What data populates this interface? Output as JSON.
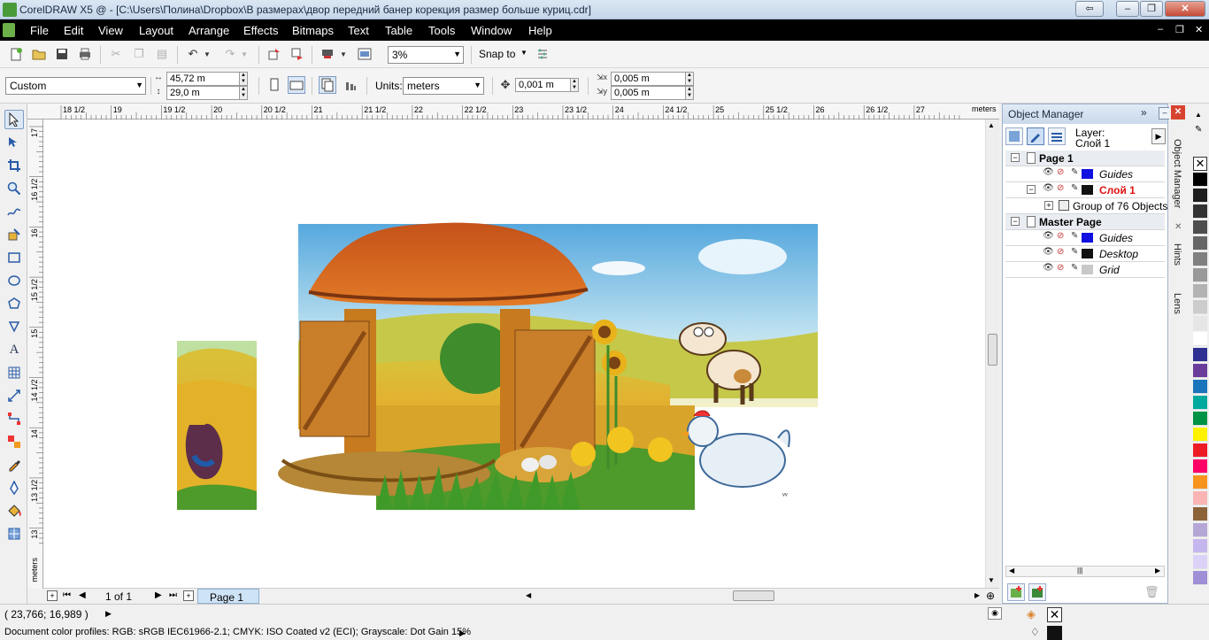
{
  "window": {
    "title": "CorelDRAW X5 @ - [C:\\Users\\Полина\\Dropbox\\В размерах\\двор передний банер корекция размер больше куриц.cdr]",
    "buttons": [
      "⇦",
      "‒",
      "❐",
      "✕"
    ]
  },
  "menu": {
    "items": [
      {
        "label": "File",
        "key": "F"
      },
      {
        "label": "Edit",
        "key": "E"
      },
      {
        "label": "View",
        "key": "V"
      },
      {
        "label": "Layout",
        "key": "L"
      },
      {
        "label": "Arrange",
        "key": "A"
      },
      {
        "label": "Effects",
        "key": "c"
      },
      {
        "label": "Bitmaps",
        "key": "B"
      },
      {
        "label": "Text",
        "key": "T"
      },
      {
        "label": "Table",
        "key": "T"
      },
      {
        "label": "Tools",
        "key": "o"
      },
      {
        "label": "Window",
        "key": "W"
      },
      {
        "label": "Help",
        "key": "H"
      }
    ],
    "mdi_buttons": [
      "‒",
      "❐",
      "✕"
    ]
  },
  "toolbar": {
    "zoom": "3%",
    "snap_to": "Snap to"
  },
  "property_bar": {
    "page_preset": "Custom",
    "width": "45,72 m",
    "height": "29,0 m",
    "units_label": "Units:",
    "units": "meters",
    "nudge": "0,001 m",
    "dup_x": "0,005 m",
    "dup_y": "0,005 m"
  },
  "ruler": {
    "h_labels": [
      "18 1/2",
      "19",
      "19 1/2",
      "20",
      "20 1/2",
      "21",
      "21 1/2",
      "22",
      "22 1/2",
      "23",
      "23 1/2",
      "24",
      "24 1/2",
      "25",
      "25 1/2",
      "26",
      "26 1/2",
      "27"
    ],
    "h_unit": "meters",
    "v_labels": [
      "17",
      "16 1/2",
      "16",
      "15 1/2",
      "15",
      "14 1/2",
      "14",
      "13 1/2",
      "13"
    ],
    "v_unit": "meters"
  },
  "page_nav": {
    "counter": "1 of 1",
    "tab": "Page 1"
  },
  "object_manager": {
    "title": "Object Manager",
    "layer_label": "Layer:",
    "layer_name": "Слой 1",
    "rows": [
      {
        "type": "page",
        "label": "Page 1"
      },
      {
        "type": "layer",
        "label": "Guides",
        "color": "#1010e0",
        "italic": true,
        "red": false
      },
      {
        "type": "layer",
        "label": "Слой 1",
        "color": "#111111",
        "italic": false,
        "red": true
      },
      {
        "type": "object",
        "label": "Group of 76 Objects"
      },
      {
        "type": "page",
        "label": "Master Page"
      },
      {
        "type": "layer",
        "label": "Guides",
        "color": "#1010e0",
        "italic": true,
        "red": false
      },
      {
        "type": "layer",
        "label": "Desktop",
        "color": "#111111",
        "italic": true,
        "red": false
      },
      {
        "type": "layer",
        "label": "Grid",
        "color": "#c8c8c8",
        "italic": true,
        "red": false
      }
    ]
  },
  "dock_tabs": [
    "Object Manager",
    "Hints",
    "Lens"
  ],
  "palette_colors": [
    "#000000",
    "#1e1e1e",
    "#333333",
    "#4d4d4d",
    "#666666",
    "#808080",
    "#999999",
    "#b3b3b3",
    "#cccccc",
    "#e6e6e6",
    "#ffffff",
    "#2e3192",
    "#6a3d9a",
    "#1b75bc",
    "#00a99d",
    "#009245",
    "#fff200",
    "#ed1c24",
    "#ff0066",
    "#f7941d",
    "#fbb4b4",
    "#8c6239",
    "#b4a7d6",
    "#c5b6ee",
    "#dcd2f7",
    "#9e8fd6"
  ],
  "status": {
    "coords": "( 23,766; 16,989 )",
    "profiles": "Document color profiles: RGB: sRGB IEC61966-2.1; CMYK: ISO Coated v2 (ECI); Grayscale: Dot Gain 15%"
  }
}
